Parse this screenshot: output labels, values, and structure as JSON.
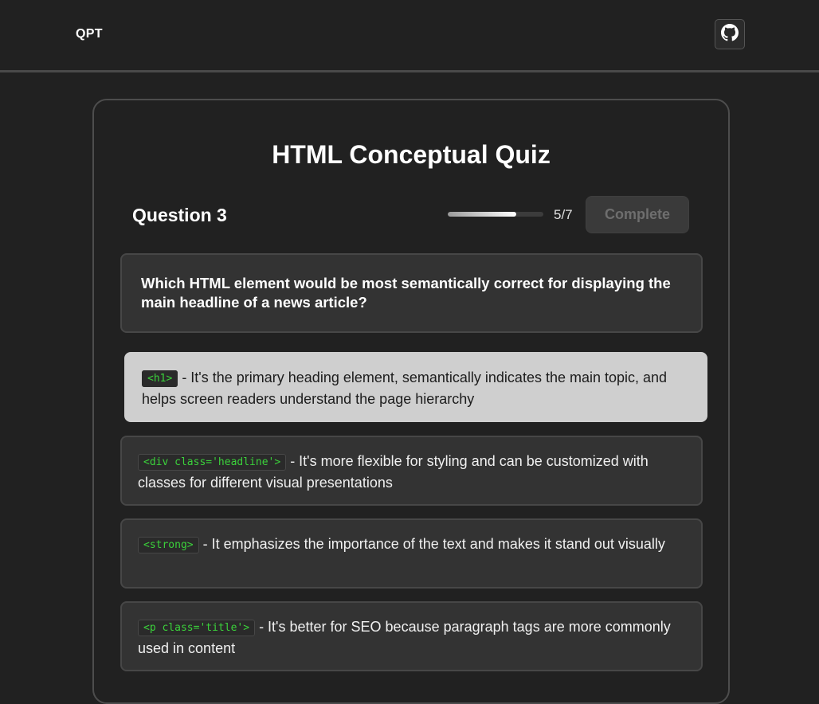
{
  "header": {
    "brand": "QPT",
    "github_icon": "github-icon"
  },
  "quiz": {
    "title": "HTML Conceptual Quiz",
    "question_label": "Question 3",
    "progress": {
      "current": 5,
      "total": 7,
      "label": "5/7",
      "fraction": 0.714
    },
    "complete_label": "Complete",
    "question_text": "Which HTML element would be most semantically correct for displaying the main headline of a news article?",
    "options": [
      {
        "code": "<h1>",
        "text": " - It's the primary heading element, semantically indicates the main topic, and helps screen readers understand the page hierarchy",
        "selected": true
      },
      {
        "code": "<div class='headline'>",
        "text": " - It's more flexible for styling and can be customized with classes for different visual presentations",
        "selected": false
      },
      {
        "code": "<strong>",
        "text": " - It emphasizes the importance of the text and makes it stand out visually",
        "selected": false
      },
      {
        "code": "<p class='title'>",
        "text": " - It's better for SEO because paragraph tags are more commonly used in content",
        "selected": false
      }
    ]
  },
  "colors": {
    "background": "#212121",
    "card_border": "#4d4d4d",
    "selected_option": "#cfcfcf",
    "code_green": "#3bd13b"
  }
}
